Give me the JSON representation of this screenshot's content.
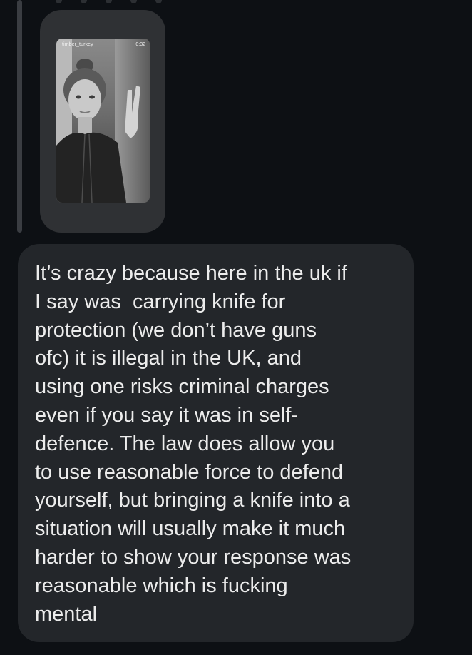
{
  "thread": {
    "story_reply": {
      "username": "timber_turkey",
      "duration": "0:32"
    },
    "message": {
      "text": "It’s crazy because here in the uk if\nI say was  carrying knife for\nprotection (we don’t have guns\nofc) it is illegal in the UK, and\nusing one risks criminal charges\neven if you say it was in self-\ndefence. The law does allow you\nto use reasonable force to defend\nyourself, but bringing a knife into a\nsituation will usually make it much\nharder to show your response was\nreasonable which is fucking\nmental"
    }
  }
}
